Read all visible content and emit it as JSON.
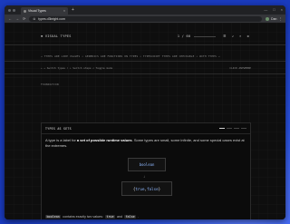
{
  "browser": {
    "tab_title": "Visual Types",
    "tab_close": "×",
    "new_tab": "+",
    "url": "types.d3bright.com",
    "profile_name": "Dan",
    "controls": {
      "minimize": "—",
      "maximize": "□",
      "close": "×"
    },
    "nav": {
      "back": "←",
      "forward": "→",
      "reload": "⟳"
    }
  },
  "header": {
    "brand": "⊞ VISUAL TYPES",
    "progress": "1 / 60",
    "icons": [
      "☰",
      "↗",
      "⌕",
      "⚙"
    ]
  },
  "ticker": "→ TYPES ARE LIKE VALUES • GENERICS ARE FUNCTIONS ON TYPES • TYPESCRIPT TYPES ARE CHECKABLE • WITH TYPES →",
  "hints": {
    "left": "← → Switch types   ↑ ↓ Switch steps   ⏎ Toggle mode",
    "right": "CLICK ANYWHERE"
  },
  "section_label": "FOUNDATION",
  "card": {
    "title": "TYPES AS SETS",
    "desc_pre": "A type is a label for ",
    "desc_bold": "a set of possible runtime values",
    "desc_post": ". Some types are small, some infinite, and some special cases exist at the extremes.",
    "box1": "boolean",
    "arrow": "↓",
    "box2_open": "{ ",
    "box2_true": "true",
    "box2_sep": ", ",
    "box2_false": "false",
    "box2_close": " }",
    "foot_code1": "boolean",
    "foot_text1": "contains exactly two values:",
    "foot_code2": "true",
    "foot_text2": "and",
    "foot_code3": "false",
    "foot_end": "."
  },
  "colors": {
    "accent": "#8fb8ff",
    "desktop": "#2b55e8",
    "page_bg": "#0e0e0e"
  }
}
